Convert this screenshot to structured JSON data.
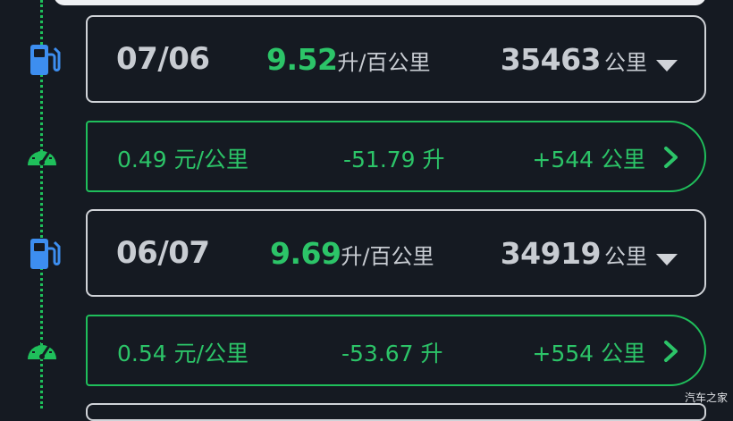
{
  "records": [
    {
      "date": "07/06",
      "consumption_value": "9.52",
      "consumption_unit": "升/百公里",
      "odometer_value": "35463",
      "odometer_unit": "公里",
      "cost_per_km": "0.49 元/公里",
      "fuel_delta": "-51.79 升",
      "distance_delta": "+544 公里"
    },
    {
      "date": "06/07",
      "consumption_value": "9.69",
      "consumption_unit": "升/百公里",
      "odometer_value": "34919",
      "odometer_unit": "公里",
      "cost_per_km": "0.54 元/公里",
      "fuel_delta": "-53.67 升",
      "distance_delta": "+554 公里"
    }
  ],
  "watermark": "汽车之家",
  "colors": {
    "accent": "#2cc468",
    "background": "#151a22",
    "text": "#c8ccd2",
    "pump_icon": "#3d8ef0"
  },
  "icons": [
    "fuel-pump-icon",
    "speedometer-icon",
    "chevron-down-icon",
    "chevron-right-icon"
  ]
}
